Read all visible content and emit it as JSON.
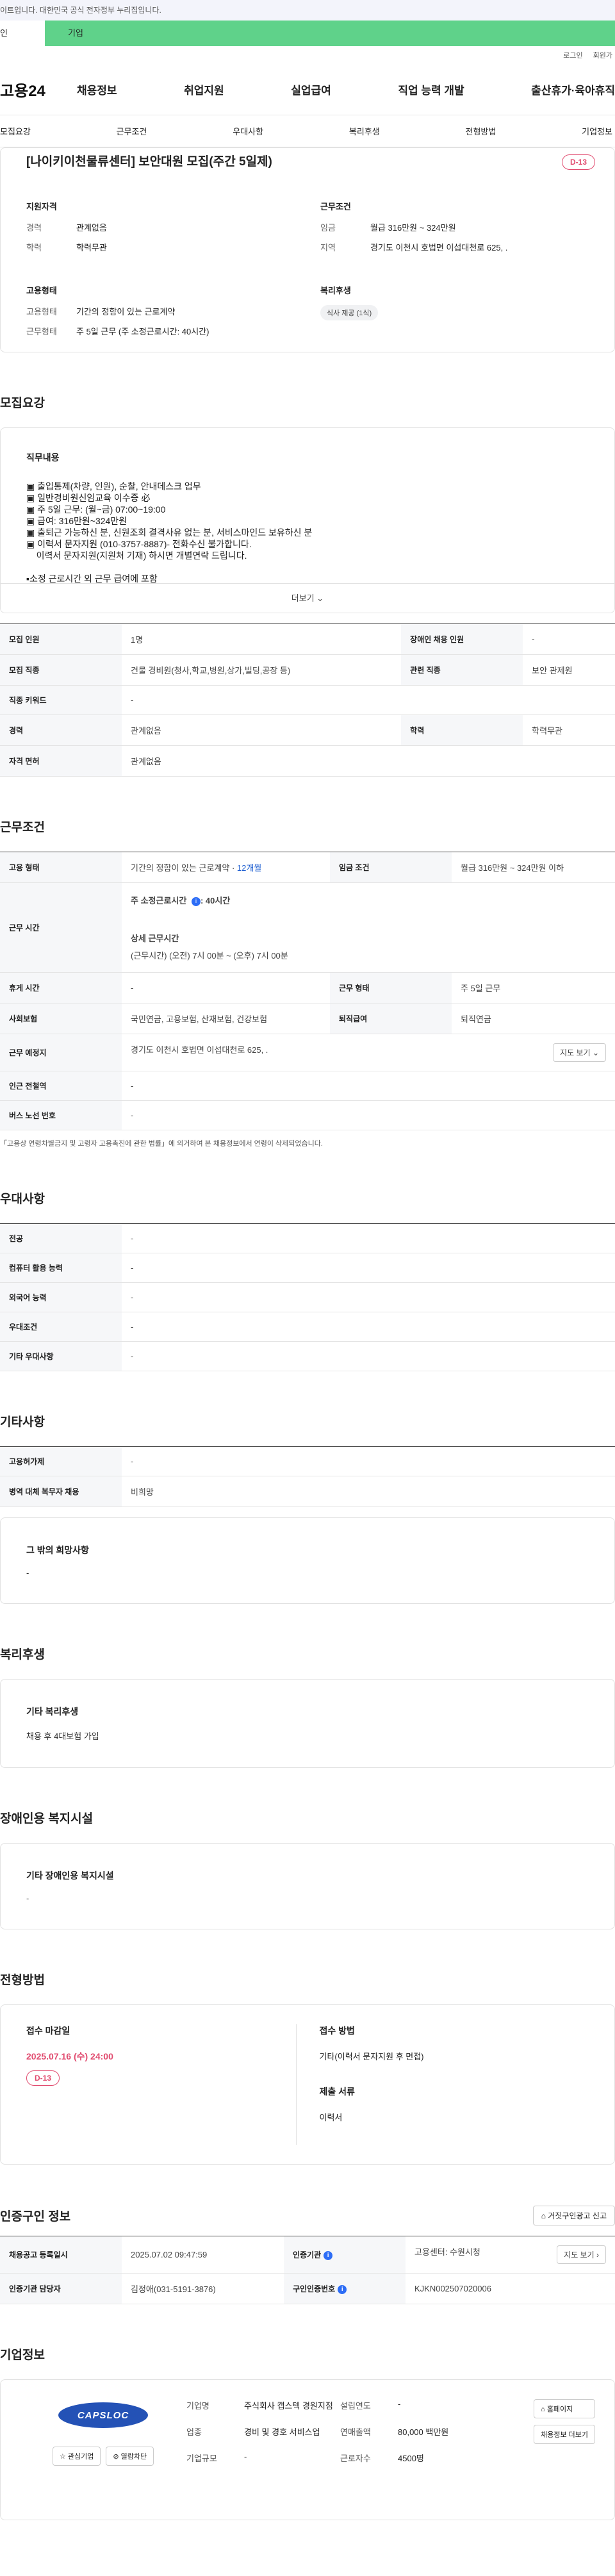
{
  "gov_bar": {
    "text": "이트입니다. 대한민국 공식 전자정부 누리집입니다."
  },
  "tabs": {
    "personal": "인",
    "company": "기업"
  },
  "util": {
    "login": "로그인",
    "join": "회원가"
  },
  "gnb": {
    "logo": "고용24",
    "items": [
      "채용정보",
      "취업지원",
      "실업급여",
      "직업 능력 개발",
      "출산휴가·육아휴직"
    ]
  },
  "subnav": [
    "모집요강",
    "근무조건",
    "우대사항",
    "복리후생",
    "전형방법",
    "기업정보"
  ],
  "summary": {
    "title": "[나이키이천물류센터] 보안대원 모집(주간 5일제)",
    "dday": "D-13",
    "qual_head": "지원자격",
    "career_k": "경력",
    "career_v": "관계없음",
    "edu_k": "학력",
    "edu_v": "학력무관",
    "cond_head": "근무조건",
    "wage_k": "임금",
    "wage_v": "월급 316만원 ~ 324만원",
    "region_k": "지역",
    "region_v": "경기도 이천시 호법면 이섭대천로 625, .",
    "emp_head": "고용형태",
    "emptype_k": "고용형태",
    "emptype_v": "기간의 정함이 있는 근로계약",
    "worktype_k": "근무형태",
    "worktype_v": "주 5일 근무 (주 소정근로시간: 40시간)",
    "welfare_head": "복리후생",
    "welfare_pill": "식사 제공 (1식)"
  },
  "recruit": {
    "section": "모집요강",
    "job_head": "직무내용",
    "job_text": "▣ 출입통제(차량, 인원), 순찰, 안내데스크 업무\n▣ 일반경비원신임교육 이수증 必\n▣ 주 5일 근무: (월~금) 07:00~19:00\n▣ 급여: 316만원~324만원\n▣ 출퇴근 가능하신 분, 신원조회 결격사유 없는 분, 서비스마인드 보유하신 분\n▣ 이력서 문자지원 (010-3757-8887)- 전화수신 불가합니다.\n    이력서 문자지원(지원처 기재) 하시면 개별연락 드립니다.\n\n▪소정 근로시간 외 근무 급여에 포함",
    "more": "더보기",
    "rows": [
      [
        "모집 인원",
        "1명",
        "장애인 채용 인원",
        "-"
      ],
      [
        "모집 직종",
        "건물 경비원(청사,학교,병원,상가,빌딩,공장 등)",
        "관련 직종",
        "보안 관제원"
      ],
      [
        "직종 키워드",
        "-"
      ],
      [
        "경력",
        "관계없음",
        "학력",
        "학력무관"
      ],
      [
        "자격 면허",
        "관계없음"
      ]
    ]
  },
  "work": {
    "section": "근무조건",
    "emp_k": "고용 형태",
    "emp_v": "기간의 정함이 있는 근로계약 · ",
    "emp_months": "12개월",
    "wage_k": "임금 조건",
    "wage_v": "월급 316만원 ~ 324만원 이하",
    "time_k": "근무 시간",
    "time_v1": "주 소정근로시간",
    "time_v1b": ": 40시간",
    "time_v2": "상세 근무시간",
    "time_v3": "(근무시간) (오전) 7시 00분 ~ (오후) 7시 00분",
    "rest_k": "휴게 시간",
    "rest_v": "-",
    "form_k": "근무 형태",
    "form_v": "주 5일 근무",
    "ins_k": "사회보험",
    "ins_v": "국민연금, 고용보험, 산재보험, 건강보험",
    "retire_k": "퇴직급여",
    "retire_v": "퇴직연금",
    "place_k": "근무 예정지",
    "place_v": "경기도 이천시 호법면 이섭대천로 625, .",
    "map_btn": "지도 보기",
    "subway_k": "인근 전철역",
    "subway_v": "-",
    "bus_k": "버스 노선 번호",
    "bus_v": "-",
    "note": "「고용상 연령차별금지 및 고령자 고용촉진에 관한 법률」에 의거하여 본 채용정보에서 연령이 삭제되었습니다."
  },
  "pref": {
    "section": "우대사항",
    "rows": [
      [
        "전공",
        "-"
      ],
      [
        "컴퓨터 활용 능력",
        "-"
      ],
      [
        "외국어 능력",
        "-"
      ],
      [
        "우대조건",
        "-"
      ],
      [
        "기타 우대사항",
        "-"
      ]
    ]
  },
  "etc": {
    "section": "기타사항",
    "rows": [
      [
        "고용허가제",
        "-"
      ],
      [
        "병역 대체 복무자 채용",
        "비희망"
      ]
    ],
    "other_head": "그 밖의 희망사항",
    "other_v": "-"
  },
  "welfare": {
    "section": "복리후생",
    "head": "기타 복리후생",
    "val": "채용  후 4대보험 가입"
  },
  "disabled": {
    "section": "장애인용 복지시설",
    "head": "기타 장애인용 복지시설",
    "val": "-"
  },
  "apply": {
    "section": "전형방법",
    "deadline_head": "접수 마감일",
    "deadline": "2025.07.16 (수) 24:00",
    "dday": "D-13",
    "method_head": "접수 방법",
    "method": "기타(이력서 문자지원 후 면접)",
    "docs_head": "제출 서류",
    "docs": "이력서"
  },
  "cert": {
    "section": "인증구인 정보",
    "report": "거짓구인광고 신고",
    "reg_k": "채용공고 등록일시",
    "reg_v": "2025.07.02 09:47:59",
    "org_k": "인증기관",
    "org_v": "고용센터: 수원시청",
    "map_btn": "지도 보기",
    "mgr_k": "인증기관 담당자",
    "mgr_v": "김정애(031-5191-3876)",
    "cert_k": "구인인증번호",
    "cert_v": "KJKN002507020006"
  },
  "company": {
    "section": "기업정보",
    "logo_text": "CAPSLOC",
    "fav_btn": "관심기업",
    "block_btn": "열람차단",
    "name_k": "기업명",
    "name_v": "주식회사 캡스텍 경원지점",
    "ind_k": "업종",
    "ind_v": "경비 및 경호 서비스업",
    "size_k": "기업규모",
    "size_v": "-",
    "year_k": "설립연도",
    "year_v": "-",
    "sales_k": "연매출액",
    "sales_v": "80,000 백만원",
    "staff_k": "근로자수",
    "staff_v": "4500명",
    "homepage_btn": "홈페이지",
    "list_btn": "채용정보 더보기"
  }
}
